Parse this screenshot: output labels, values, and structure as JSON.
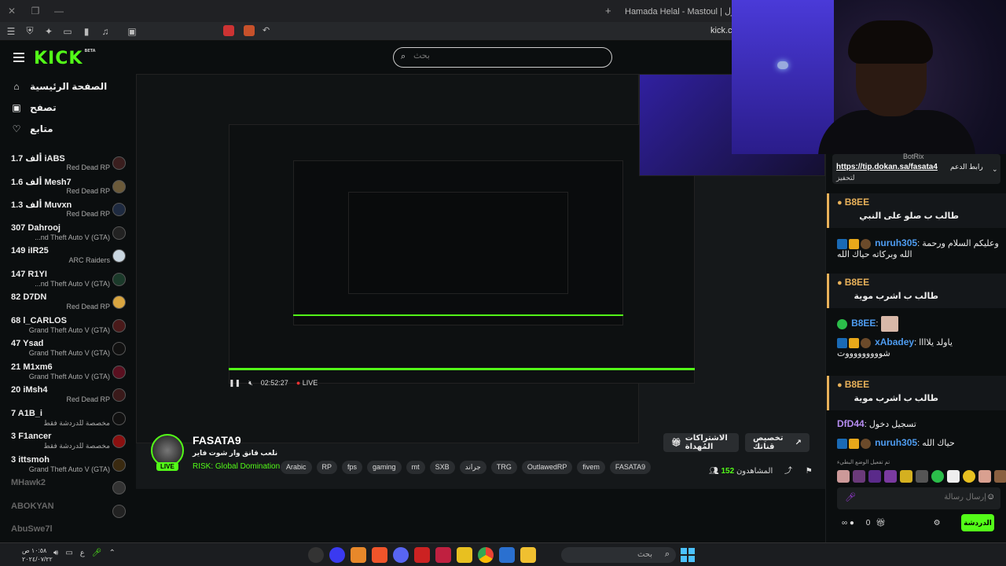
{
  "browser": {
    "window_title": "Hamada Helal - Mastoul | مسطول",
    "url": "kick.co",
    "new_tab": "+"
  },
  "site": {
    "logo": "KICK",
    "logo_beta": "BETA",
    "search_placeholder": "بحث",
    "nav": [
      {
        "label": "الصفحة الرئيسية",
        "icon": "home-icon"
      },
      {
        "label": "تصفح",
        "icon": "browse-icon"
      },
      {
        "label": "متابع",
        "icon": "heart-icon"
      }
    ],
    "channels": [
      {
        "viewers": "1.7 ألف",
        "name": "iABS",
        "game": "Red Dead RP"
      },
      {
        "viewers": "1.6 ألف",
        "name": "Mesh7",
        "game": "Red Dead RP"
      },
      {
        "viewers": "1.3 ألف",
        "name": "Muvxn",
        "game": "Red Dead RP"
      },
      {
        "viewers": "307",
        "name": "Dahrooj",
        "game": "...nd Theft Auto V (GTA)"
      },
      {
        "viewers": "149",
        "name": "iIR25",
        "game": "ARC Raiders"
      },
      {
        "viewers": "147",
        "name": "R1YI",
        "game": "...nd Theft Auto V (GTA)"
      },
      {
        "viewers": "82",
        "name": "D7DN",
        "game": "Red Dead RP"
      },
      {
        "viewers": "68",
        "name": "l_CARLOS",
        "game": "Grand Theft Auto V (GTA)"
      },
      {
        "viewers": "47",
        "name": "Ysad",
        "game": "Grand Theft Auto V (GTA)"
      },
      {
        "viewers": "21",
        "name": "M1xm6",
        "game": "Grand Theft Auto V (GTA)"
      },
      {
        "viewers": "20",
        "name": "iMsh4",
        "game": "Red Dead RP"
      },
      {
        "viewers": "7",
        "name": "A1B_i",
        "game": "مخصصة للدردشة فقط"
      },
      {
        "viewers": "3",
        "name": "F1ancer",
        "game": "مخصصة للدردشة فقط"
      },
      {
        "viewers": "3",
        "name": "ittsmoh",
        "game": "Grand Theft Auto V (GTA)"
      },
      {
        "viewers": "",
        "name": "MHawk2",
        "game": ""
      },
      {
        "viewers": "",
        "name": "ABOKYAN",
        "game": ""
      },
      {
        "viewers": "",
        "name": "AbuSwe7l",
        "game": ""
      }
    ]
  },
  "player": {
    "time": "02:52:27",
    "live": "LIVE"
  },
  "streamer": {
    "name": "FASATA9",
    "title": "نلعب قانق وار شوت فاير",
    "game": "RISK: Global Domination",
    "tags": [
      "Arabic",
      "RP",
      "fps",
      "gaming",
      "mt",
      "SXB",
      "جراند",
      "TRG",
      "OutlawedRP",
      "fivem",
      "FASATA9"
    ],
    "live_badge": "LIVE",
    "subscribe_label": "الاشتراكات المُهداة",
    "customize_label": "تخصيص قناتك",
    "viewers_count": "152",
    "viewers_label": "المشاهدون"
  },
  "chat": {
    "pinned_link": "https://tip.dokan.sa/fasata4",
    "pinned_label": "رابط الدعم",
    "pinned_line2": "لتحفيز",
    "pinned_user": "BotRix",
    "messages": [
      {
        "user": "B8EE",
        "text": "طالب ب صلو على النبي",
        "color": "#e8b15a",
        "highlight": true
      },
      {
        "user": "nuruh305",
        "text": "وعليكم السلام ورحمة الله وبركاته حياك الله",
        "color": "#4e9cf0",
        "highlight": false
      },
      {
        "user": "B8EE",
        "text": "طالب ب اشرب موية",
        "color": "#e8b15a",
        "highlight": true
      },
      {
        "user": "B8EE",
        "text": "",
        "color": "#4e9cf0",
        "highlight": false
      },
      {
        "user": "xAbadey",
        "text": "ياولد يلاااا شوووووووووت",
        "color": "#4e9cf0",
        "highlight": false
      },
      {
        "user": "B8EE",
        "text": "طالب ب اشرب موية",
        "color": "#e8b15a",
        "highlight": true
      },
      {
        "user": "DfD44",
        "text": "تسجيل دخول",
        "color": "#b58cf0",
        "highlight": false
      },
      {
        "user": "nuruh305",
        "text": "حياك الله",
        "color": "#4e9cf0",
        "highlight": false
      }
    ],
    "emote_note": "تم تفعيل الوضع البطيء",
    "input_placeholder": "إرسال رسالة",
    "send_label": "الدردشة",
    "points": "0"
  },
  "taskbar": {
    "time": "١٠:٥٨ ص",
    "date": "٢٠٢٤/٠٧/٢٢",
    "search_placeholder": "بحث",
    "lang": "ع"
  },
  "colors": {
    "accent": "#53fc18",
    "background": "#0b0e0f",
    "panel": "#1c1f21"
  }
}
